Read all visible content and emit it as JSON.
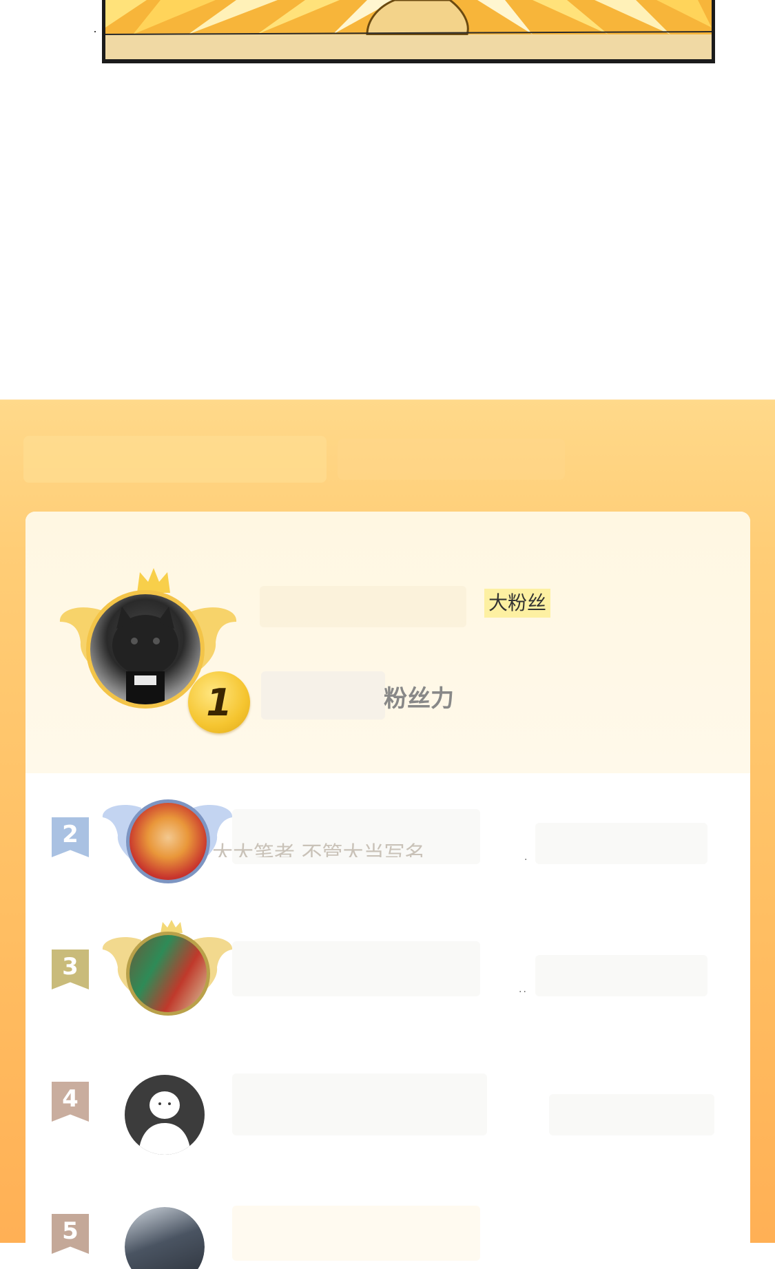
{
  "comic": {
    "colors": {
      "rays": "#f7b53a",
      "rays_light": "#ffe27a",
      "floor": "#f0d9a4",
      "border": "#1b1b1b"
    },
    "icon": "comic-panel-sunburst"
  },
  "fan_ranking": {
    "colors": {
      "panel_top": "#ffd98a",
      "panel_bottom": "#ffb055",
      "card": "#ffffff",
      "gold": "#f5c530",
      "silver": "#a9c1e2",
      "bronze": "#c9bb7a"
    },
    "first_place": {
      "rank": "1",
      "badge": "大粉丝",
      "score_label": "粉丝力",
      "avatar_icon": "cat-avatar"
    },
    "others": [
      {
        "rank": "2",
        "avatar_icon": "anime-boy-avatar",
        "trail": "."
      },
      {
        "rank": "3",
        "avatar_icon": "photo-avatar",
        "trail": ".."
      },
      {
        "rank": "4",
        "avatar_icon": "default-user-avatar",
        "trail": ""
      },
      {
        "rank": "5",
        "avatar_icon": "anime-warrior-avatar",
        "trail": ""
      }
    ],
    "partial_comment": "大大笔者 不管大当写名"
  }
}
